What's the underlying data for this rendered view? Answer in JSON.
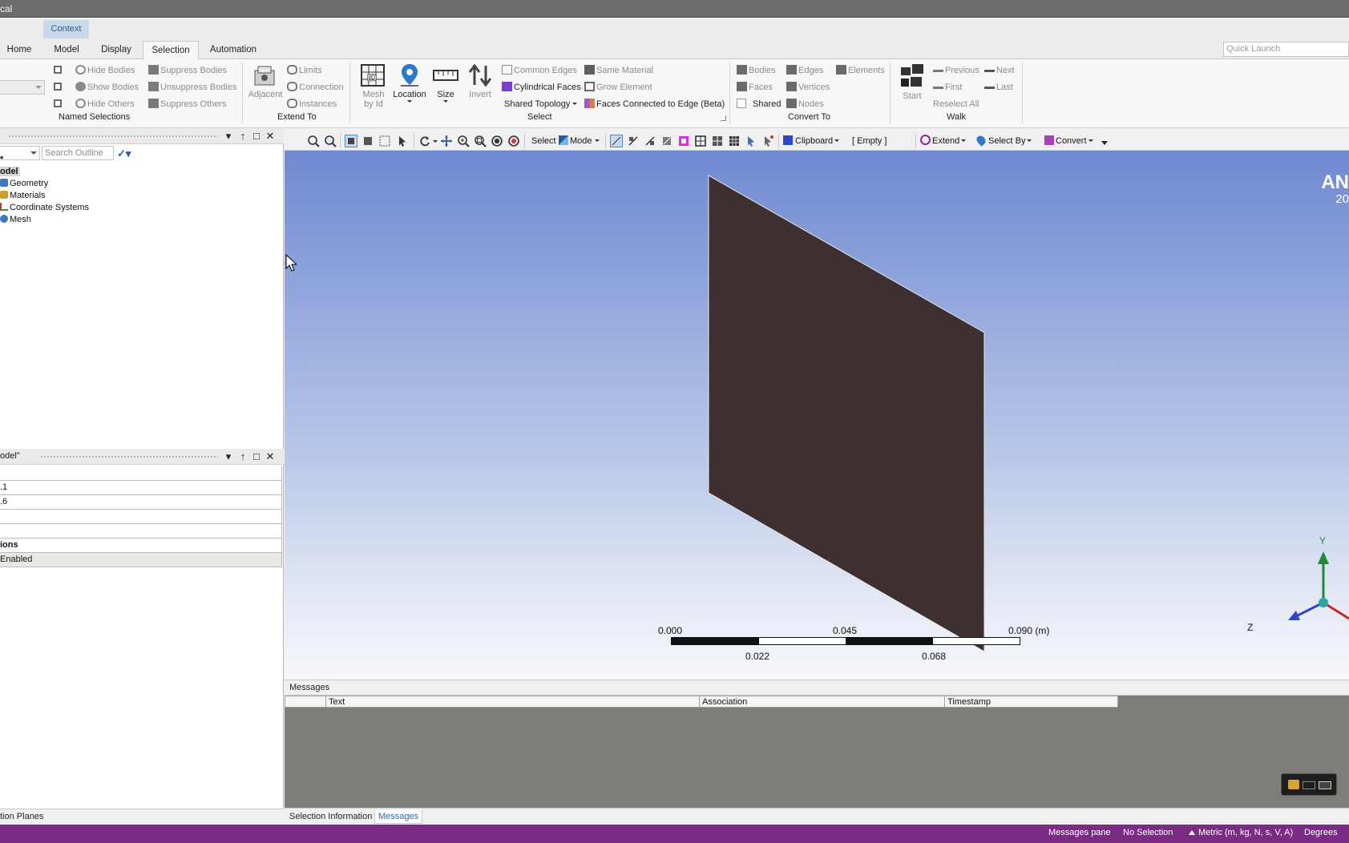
{
  "app": {
    "title_fragment": "cal"
  },
  "context_tab": {
    "label": "Context"
  },
  "tabs": [
    {
      "label": "Home"
    },
    {
      "label": "Model"
    },
    {
      "label": "Display"
    },
    {
      "label": "Selection",
      "active": true
    },
    {
      "label": "Automation"
    }
  ],
  "quick_launch": {
    "placeholder": "Quick Launch"
  },
  "ribbon": {
    "named_selections": {
      "label": "Named Selections",
      "items": [
        "Hide Bodies",
        "Show Bodies",
        "Hide Others",
        "Suppress Bodies",
        "Unsuppress Bodies",
        "Suppress Others"
      ]
    },
    "extend_to": {
      "label": "Extend To",
      "adjacent": "Adjacent",
      "items": [
        "Limits",
        "Connection",
        "Instances"
      ]
    },
    "select": {
      "label": "Select",
      "mesh_by_id": [
        "Mesh",
        "by Id"
      ],
      "location": "Location",
      "size": "Size",
      "invert": "Invert",
      "items": [
        "Common Edges",
        "Cylindrical Faces",
        "Shared Topology",
        "Same Material",
        "Grow Element",
        "Faces Connected to Edge (Beta)"
      ]
    },
    "convert_to": {
      "label": "Convert To",
      "items": [
        "Bodies",
        "Edges",
        "Elements",
        "Faces",
        "Vertices",
        "Shared",
        "Nodes"
      ]
    },
    "walk": {
      "label": "Walk",
      "start": "Start",
      "items": [
        "Previous",
        "Next",
        "First",
        "Last",
        "Reselect All"
      ]
    }
  },
  "outline": {
    "search_placeholder": "Search Outline",
    "star": "*",
    "root": "odel",
    "items": [
      "Geometry",
      "Materials",
      "Coordinate Systems",
      "Mesh"
    ]
  },
  "details": {
    "title": "odel\"",
    "rows": [
      "",
      ".1",
      ".6",
      "",
      "",
      "ions",
      "Enabled"
    ]
  },
  "left_bottom_tab": "tion Planes",
  "graphics_toolbar": {
    "select": "Select",
    "mode": "Mode",
    "clipboard": "Clipboard",
    "empty": "[ Empty ]",
    "extend": "Extend",
    "select_by": "Select By",
    "convert": "Convert"
  },
  "viewport": {
    "brand": "AN",
    "brand_sub": "20",
    "scale_top": [
      "0.000",
      "0.045",
      "0.090 (m)"
    ],
    "scale_bottom": [
      "0.022",
      "0.068"
    ],
    "triad": {
      "y": "Y",
      "z": "Z"
    }
  },
  "messages": {
    "title": "Messages",
    "columns": [
      "Text",
      "Association",
      "Timestamp"
    ]
  },
  "bottom_tabs": [
    {
      "label": "Selection Information"
    },
    {
      "label": "Messages",
      "active": true
    }
  ],
  "status_bar": {
    "messages_pane": "Messages pane",
    "selection": "No Selection",
    "units": "Metric (m, kg, N, s, V, A)",
    "angle": "Degrees"
  },
  "colors": {
    "status_bar": "#7a2c84",
    "viewport_top": "#7089d1",
    "body_face": "#3e3030",
    "active_tab_text": "#2c6aa7"
  }
}
